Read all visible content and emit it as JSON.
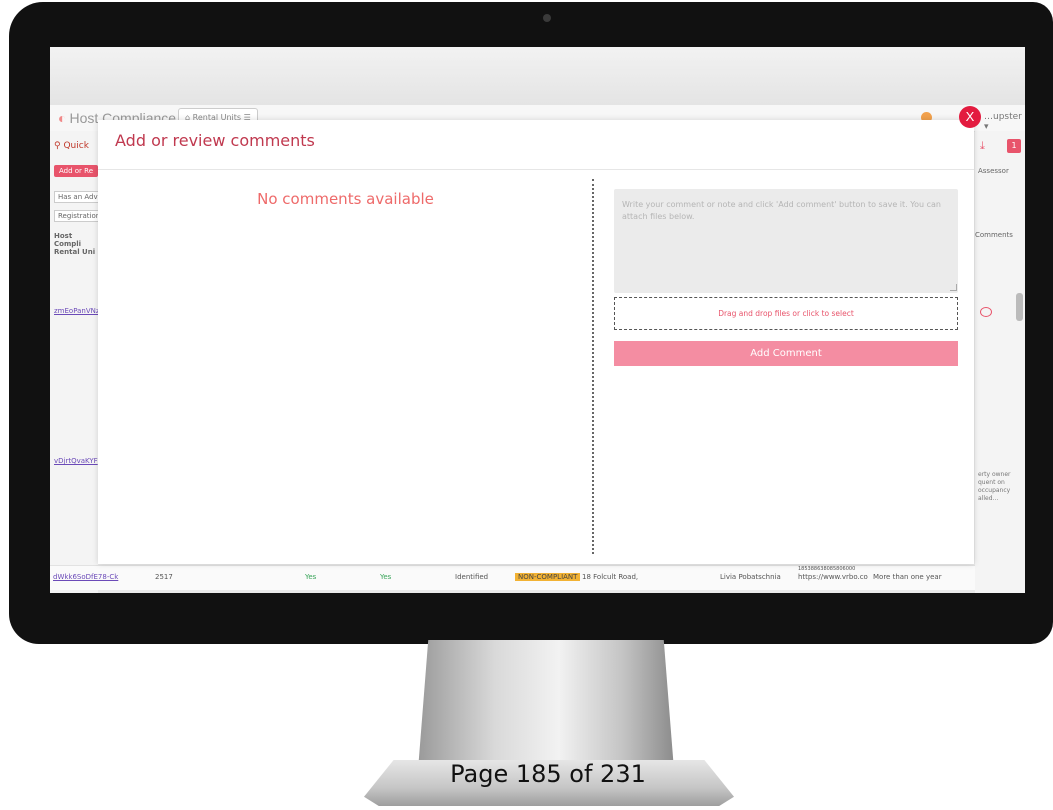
{
  "app": {
    "logo_text": "Host Compliance",
    "nav_tab_label": "Rental Units",
    "user_name": "…upster"
  },
  "background": {
    "quick_search": "Quick",
    "add_button": "Add or Re",
    "filter_1": "Has an Adv",
    "filter_2": "Registration",
    "column_header": "Host Compli Rental Uni",
    "row_ids": [
      "zmEoPanVNzo",
      "vDjrtQvaKYF",
      "dWkk6SoDfE78-Ck"
    ],
    "assessor_label": "Assessor",
    "comments_column": "Comments",
    "badge_count": "1",
    "note_text": "erty owner quent on occupancy alled...",
    "last_row": {
      "id": "dWkk6SoDfE78-Ck",
      "count": "2517",
      "col_yes_1": "Yes",
      "col_yes_2": "Yes",
      "status": "Identified",
      "compliance": "NON-COMPLIANT",
      "address": "18 Folcult Road,",
      "owner": "Livia Pobatschnia",
      "url": "https://www.vrbo.co",
      "duration": "More than one year",
      "small_code": "185388638085806000"
    }
  },
  "modal": {
    "title": "Add or review comments",
    "close_label": "X",
    "empty_message": "No comments available",
    "textarea_placeholder": "Write your comment or note and click 'Add comment' button to save it. You can attach files below.",
    "dropzone_text": "Drag and drop files or click to select",
    "add_button_label": "Add Comment"
  },
  "footer": {
    "page_indicator": "Page 185 of 231"
  },
  "colors": {
    "accent": "#e8546b",
    "title": "#c0394f",
    "button": "#f48da2",
    "close": "#e31b3f"
  }
}
